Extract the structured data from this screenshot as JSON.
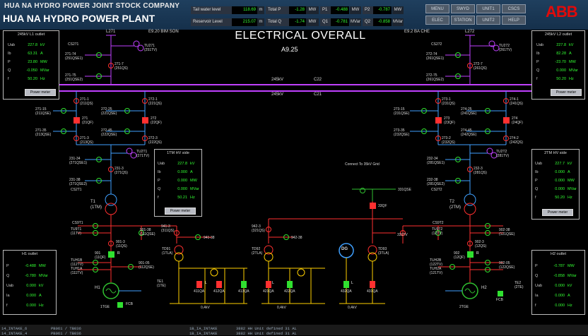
{
  "header": {
    "company": "HUA NA HYDRO POWER JOINT STOCK COMPANY",
    "plant": "HUA NA HYDRO POWER PLANT",
    "brand": "ABB",
    "accent": "#1f3f5e"
  },
  "measurements": [
    {
      "label": "Tail water level",
      "value": "118.69",
      "unit": "m"
    },
    {
      "label": "Reservoir Level",
      "value": "215.07",
      "unit": "m"
    },
    {
      "label": "Total P",
      "value": "-1.28",
      "unit": "MW"
    },
    {
      "label": "Total Q",
      "value": "-1.74",
      "unit": "MW"
    },
    {
      "label": "P1",
      "value": "-0.488",
      "unit": "MW"
    },
    {
      "label": "Q1",
      "value": "-0.781",
      "unit": "MVar"
    },
    {
      "label": "P2",
      "value": "-0.787",
      "unit": "MW"
    },
    {
      "label": "Q2",
      "value": "-0.858",
      "unit": "MVar"
    }
  ],
  "nav": [
    "MENU",
    "SWYD",
    "UNIT1",
    "CSCS",
    "ELEC",
    "STATION",
    "UNIT2",
    "HELP"
  ],
  "page": {
    "title": "ELECTRICAL OVERALL",
    "code": "A9.25"
  },
  "feeders": {
    "left": "E9.20 BIM SON",
    "right": "E9.2 BA CHE",
    "left_line": "L271",
    "right_line": "L272"
  },
  "busbars": {
    "top": {
      "kv": "245kV",
      "name": "C22"
    },
    "bottom": {
      "kv": "245kV",
      "name": "C21"
    }
  },
  "panels": {
    "l1": {
      "title": "245kV L1 outlet",
      "rows": [
        {
          "l": "Uab",
          "v": "227.8",
          "u": "kV"
        },
        {
          "l": "Ib",
          "v": "63.31",
          "u": "A"
        },
        {
          "l": "P",
          "v": "23.80",
          "u": "MW"
        },
        {
          "l": "Q",
          "v": "-0.050",
          "u": "MVar"
        },
        {
          "l": "f",
          "v": "50.20",
          "u": "Hz"
        }
      ],
      "button": "Power meter"
    },
    "l2": {
      "title": "245kV L2 outlet",
      "rows": [
        {
          "l": "Uab",
          "v": "227.8",
          "u": "kV"
        },
        {
          "l": "Ib",
          "v": "82.28",
          "u": "A"
        },
        {
          "l": "P",
          "v": "-23.70",
          "u": "MW"
        },
        {
          "l": "Q",
          "v": "0.000",
          "u": "MVar"
        },
        {
          "l": "f",
          "v": "50.20",
          "u": "Hz"
        }
      ],
      "button": "Power meter"
    },
    "t1": {
      "title": "1TM HV side",
      "rows": [
        {
          "l": "Uab",
          "v": "227.8",
          "u": "kV"
        },
        {
          "l": "Ib",
          "v": "0.000",
          "u": "A"
        },
        {
          "l": "P",
          "v": "0.000",
          "u": "MW"
        },
        {
          "l": "Q",
          "v": "0.000",
          "u": "MVar"
        },
        {
          "l": "f",
          "v": "50.21",
          "u": "Hz"
        }
      ],
      "button": "Power meter"
    },
    "t2": {
      "title": "2TM HV side",
      "rows": [
        {
          "l": "Uab",
          "v": "227.7",
          "u": "kV"
        },
        {
          "l": "Ib",
          "v": "0.000",
          "u": "A"
        },
        {
          "l": "P",
          "v": "0.000",
          "u": "MW"
        },
        {
          "l": "Q",
          "v": "0.000",
          "u": "MVar"
        },
        {
          "l": "f",
          "v": "50.20",
          "u": "Hz"
        }
      ],
      "button": "Power meter"
    },
    "h1": {
      "title": "H1 outlet",
      "rows": [
        {
          "l": "P",
          "v": "-0.488",
          "u": "MW"
        },
        {
          "l": "Q",
          "v": "-0.780",
          "u": "MVar"
        },
        {
          "l": "Uab",
          "v": "0.000",
          "u": "kV"
        },
        {
          "l": "Ia",
          "v": "0.000",
          "u": "A"
        },
        {
          "l": "f",
          "v": "0.000",
          "u": "Hz"
        }
      ]
    },
    "h2": {
      "title": "H2 outlet",
      "rows": [
        {
          "l": "P",
          "v": "-0.787",
          "u": "MW"
        },
        {
          "l": "Q",
          "v": "-0.858",
          "u": "MVar"
        },
        {
          "l": "Uab",
          "v": "0.000",
          "u": "kV"
        },
        {
          "l": "Ia",
          "v": "0.000",
          "u": "A"
        },
        {
          "l": "f",
          "v": "0.000",
          "u": "Hz"
        }
      ]
    }
  },
  "labels": {
    "cs271": "CS271",
    "tu271": "TU271\n(251TV)",
    "ql2714": "271-74\n(251QSE1)",
    "ql2717": "271-7\n(251QS)",
    "ql2715": "271-75\n(251QSE2)",
    "cs272": "CS272",
    "tu272": "TU272\n(261TV)",
    "qr2724": "272-74\n(261QSE1)",
    "qr2727": "272-7\n(261QS)",
    "qr2725": "272-75\n(261QSE2)",
    "q2711": "271-1\n(211QS)",
    "q2721": "272-1\n(221QS)",
    "q2731": "273-1\n(231QS)",
    "q2741": "274-1\n(241QS)",
    "q27115": "271-15\n(211QSE)",
    "q27225": "272-25\n(221QSE)",
    "q273": "273-15\n(231QSE)",
    "q27425": "274-25\n(241QSE)",
    "cb271": "271\n(21QF)",
    "cb272": "272\n(22QF)",
    "cb273": "273\n(23QF)",
    "cb274": "274\n(24QF)",
    "q27135": "271-35\n(213QSE)",
    "q27245": "272-45\n(222QSE)",
    "q273b": "273-35\n(232QSE)",
    "q27445": "274-45\n(242QSE)",
    "q2713": "271-3\n(213QS)",
    "q2722": "272-3\n(222QS)",
    "q2732": "273-2\n(232QS)",
    "q2742": "274-2\n(242QS)",
    "tu2t1": "TU2T1\n(271TV)",
    "tu2t2": "TU2T2\n(281TV)",
    "q23134": "231-34\n(271QSE1)",
    "q2313": "231-3\n(271QS)",
    "q23138": "231-38\n(271QSE2)",
    "cs2t1": "CS2T1",
    "q23234": "232-34\n(281QSE1)",
    "q2323": "232-3\n(281QS)",
    "q23238": "232-38\n(281QSE2)",
    "cs2t2": "CS2T2",
    "t1": "T1\n(1TM)",
    "t2": "T2\n(2TM)",
    "grid": "Connect To 35kV Grid",
    "q331": "331QSE",
    "cb33": "33QF",
    "tv331": "331TV",
    "cs9t1": "CS9T1",
    "tu9t1": "TU9T1\n(11TV)",
    "cs9t2": "CS9T2",
    "tu9t2": "TU9T2\n(12TV)",
    "q90138": "901-38\n(111QSE)",
    "q9413": "941-3\n(311QS)",
    "q94138": "941-38",
    "q9013": "901-3\n(11QS)",
    "q9423": "942-3\n(321QS)",
    "q94238": "942-38",
    "q90238": "902-38\n(121QSE)",
    "q9023": "902-3\n(12QS)",
    "td91": "TD91\n(1TLA)",
    "td92": "TD92\n(2TLA)",
    "td93": "TD93\n(3TLA)",
    "dg": "DG",
    "cb901": "901\n(11QF)",
    "cb902": "902\n(12QF)",
    "tuh1b": "TUH1B\n(112TV)",
    "tuh1a": "TUH1A\n(111TV)",
    "q90105": "901-05\n(112QSE)",
    "tuh2b": "TUH2B\n(122TV)",
    "tuh2a": "TUH2A\n(121TV)",
    "q90205": "902-05\n(122QSE)",
    "te1": "TE1\n(1TE)",
    "te2": "TE2\n(2TE)",
    "fcb": "FCB",
    "tge1": "1TGE",
    "tge2": "2TGE",
    "h1": "H1",
    "h2": "H2",
    "qa411": "411QA",
    "qa412": "412QA",
    "qa413": "413QA",
    "qa421": "421QA",
    "qa422": "422QA",
    "qa432": "432QA",
    "qa431": "431QA",
    "b04a": "0,4kV",
    "b04b": "0,4kV",
    "b04c": "0,4kV",
    "R": "R",
    "L": "L"
  },
  "statusbar": [
    "14_INTAKE_6",
    "PB061 / TB036",
    "1B_IA_INTAKE",
    "3882 HH Unit defined 31 AL",
    "14_INTAKE_4",
    "PB061 / TB036",
    "1B_IA_INTAKE",
    "3882 HH Unit defined 31 AL"
  ],
  "colors": {
    "bus": "#c040ff",
    "hv": "#3fa0ff",
    "mv": "#ff3030",
    "lv": "#ffd000",
    "grid": "#30c030",
    "open": "#30e030",
    "closed": "#ff3030"
  }
}
